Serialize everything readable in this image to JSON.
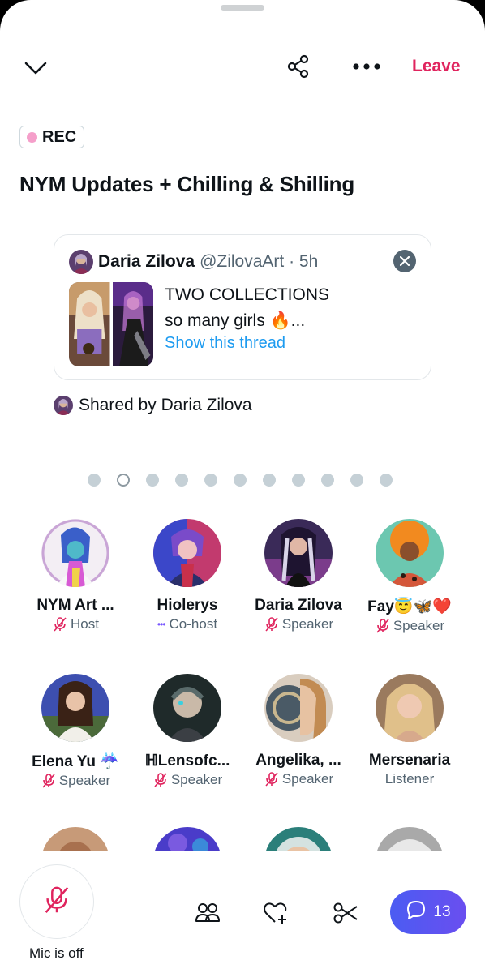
{
  "header": {
    "leave_label": "Leave",
    "accent": "#e0245e"
  },
  "space": {
    "rec_label": "REC",
    "title": "NYM Updates + Chilling & Shilling"
  },
  "pinned_tweet": {
    "author": "Daria Zilova",
    "handle_time": "@ZilovaArt · 5h",
    "line1": "TWO COLLECTIONS",
    "line2": "so many girls 🔥...",
    "show_thread": "Show this thread",
    "shared_by": "Shared by Daria Zilova"
  },
  "pager": {
    "count": 11,
    "active_index": 1
  },
  "participants": [
    {
      "name": "NYM Art ...",
      "role": "Host",
      "mic": "off"
    },
    {
      "name": "Hiolerys",
      "role": "Co-host",
      "mic": "speaking"
    },
    {
      "name": "Daria Zilova",
      "role": "Speaker",
      "mic": "off"
    },
    {
      "name": "Fay😇🦋❤️",
      "role": "Speaker",
      "mic": "off"
    },
    {
      "name": "Elena Yu ☔",
      "role": "Speaker",
      "mic": "off"
    },
    {
      "name": "ℍLensofc...",
      "role": "Speaker",
      "mic": "off"
    },
    {
      "name": "Angelika, ...",
      "role": "Speaker",
      "mic": "off"
    },
    {
      "name": "Mersenaria",
      "role": "Listener",
      "mic": "none"
    }
  ],
  "bottom_bar": {
    "mic_label": "Mic is off",
    "comments_count": "13",
    "icons": [
      "people-icon",
      "heart-plus-icon",
      "scissors-icon",
      "chat-bubble-icon"
    ]
  }
}
